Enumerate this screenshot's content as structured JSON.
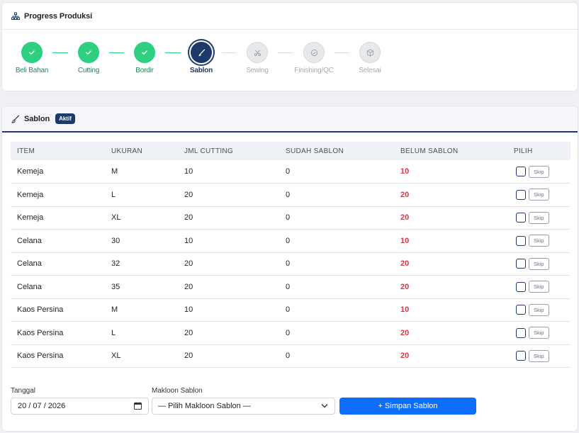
{
  "progress": {
    "title": "Progress Produksi",
    "steps": [
      {
        "label": "Beli Bahan",
        "status": "done",
        "icon": "check-icon"
      },
      {
        "label": "Cutting",
        "status": "done",
        "icon": "check-icon"
      },
      {
        "label": "Bordir",
        "status": "done",
        "icon": "check-icon"
      },
      {
        "label": "Sablon",
        "status": "active",
        "icon": "brush-icon"
      },
      {
        "label": "Sewing",
        "status": "todo",
        "icon": "scissors-icon"
      },
      {
        "label": "Finishing/QC",
        "status": "todo",
        "icon": "check-circle-icon"
      },
      {
        "label": "Selesai",
        "status": "todo",
        "icon": "box-icon"
      }
    ]
  },
  "sablon": {
    "title": "Sablon",
    "badge": "Aktif",
    "columns": [
      "ITEM",
      "UKURAN",
      "JML CUTTING",
      "SUDAH SABLON",
      "BELUM SABLON",
      "PILIH"
    ],
    "rows": [
      {
        "item": "Kemeja",
        "ukuran": "M",
        "jml_cutting": "10",
        "sudah": "0",
        "belum": "10"
      },
      {
        "item": "Kemeja",
        "ukuran": "L",
        "jml_cutting": "20",
        "sudah": "0",
        "belum": "20"
      },
      {
        "item": "Kemeja",
        "ukuran": "XL",
        "jml_cutting": "20",
        "sudah": "0",
        "belum": "20"
      },
      {
        "item": "Celana",
        "ukuran": "30",
        "jml_cutting": "10",
        "sudah": "0",
        "belum": "10"
      },
      {
        "item": "Celana",
        "ukuran": "32",
        "jml_cutting": "20",
        "sudah": "0",
        "belum": "20"
      },
      {
        "item": "Celana",
        "ukuran": "35",
        "jml_cutting": "20",
        "sudah": "0",
        "belum": "20"
      },
      {
        "item": "Kaos Persina",
        "ukuran": "M",
        "jml_cutting": "10",
        "sudah": "0",
        "belum": "10"
      },
      {
        "item": "Kaos Persina",
        "ukuran": "L",
        "jml_cutting": "20",
        "sudah": "0",
        "belum": "20"
      },
      {
        "item": "Kaos Persina",
        "ukuran": "XL",
        "jml_cutting": "20",
        "sudah": "0",
        "belum": "20"
      }
    ],
    "skip_label": "Skip",
    "form": {
      "tanggal_label": "Tanggal",
      "tanggal_value": "20 / 07 / 2026",
      "makloon_label": "Makloon Sablon",
      "makloon_value": "— Pilih Makloon Sablon —",
      "submit_label": "+ Simpan Sablon"
    }
  },
  "colors": {
    "done": "#2fcf81",
    "active": "#1d3a6b",
    "todo": "#e6e8eb",
    "belum": "#dc3545",
    "primary": "#0d6efd"
  }
}
